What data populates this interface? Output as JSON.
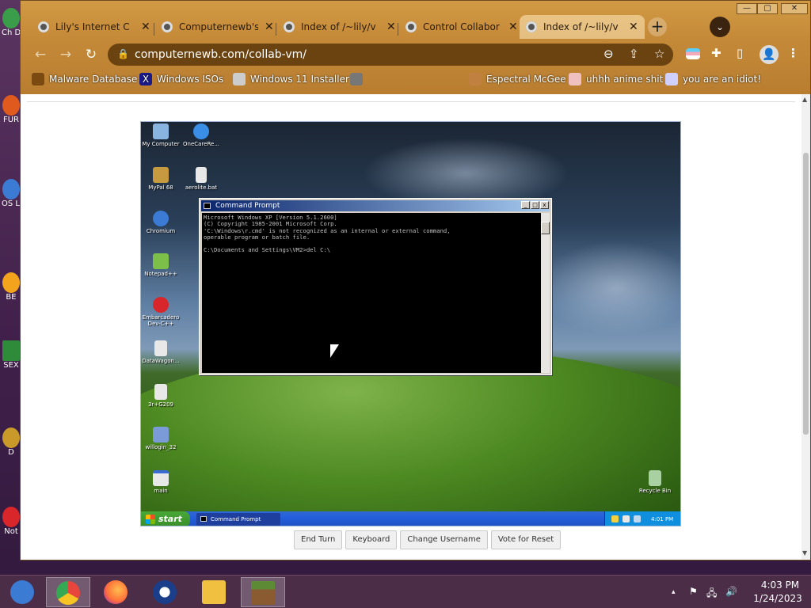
{
  "host_desktop": {
    "icons": [
      {
        "label": "Ch\nD",
        "color": "#3a9d4a"
      },
      {
        "label": "FUR",
        "color": "#e05a1e"
      },
      {
        "label": "OS\nLAU",
        "color": "#3b7bd4"
      },
      {
        "label": "BE",
        "color": "#f4a31c"
      },
      {
        "label": "SEX",
        "color": "#2e8b3a"
      },
      {
        "label": "D",
        "color": "#c99a2a"
      },
      {
        "label": "Not",
        "color": "#d8262a"
      }
    ]
  },
  "browser": {
    "tabs": [
      {
        "title": "Lily's Internet C",
        "active": false
      },
      {
        "title": "Computernewb's",
        "active": false
      },
      {
        "title": "Index of /~lily/v",
        "active": false
      },
      {
        "title": "Control Collabor",
        "active": false
      },
      {
        "title": "Index of /~lily/v",
        "active": true
      }
    ],
    "tab_close": "✕",
    "new_tab": "+",
    "tab_search": "⌄",
    "window_buttons": {
      "minimize": "—",
      "maximize": "▢",
      "close": "✕"
    },
    "nav": {
      "back": "←",
      "forward": "→",
      "reload": "↻"
    },
    "address": {
      "lock": "🔒",
      "url": "computernewb.com/collab-vm/"
    },
    "omnibox_icons": {
      "zoom": "⊖",
      "share": "⇪",
      "bookmark": "☆"
    },
    "ext_icons": {
      "extensions": "✚",
      "sidepanel": "▯",
      "profile": "👤",
      "menu": "⋮"
    },
    "bookmarks": [
      {
        "label": "Malware Database",
        "color": "#7a4a10"
      },
      {
        "label": "Windows ISOs",
        "color": "#1a1a8a"
      },
      {
        "label": "Windows 11 Installer",
        "color": "#ccc"
      },
      {
        "label": "",
        "color": "#777"
      },
      {
        "label": "Espectral McGee",
        "color": "#c08040"
      },
      {
        "label": "uhhh anime shit",
        "color": "#f0c0c0"
      },
      {
        "label": "you are an idiot!",
        "color": "#d0d0ff"
      }
    ],
    "scroll_up": "▲",
    "scroll_down": "▼"
  },
  "vm": {
    "desktop_icons": [
      {
        "label": "My Computer",
        "color": "#8ab4e0"
      },
      {
        "label": "OneCareRe...",
        "color": "#3a8ee6"
      },
      {
        "label": "MyPal 68",
        "color": "#c89a40"
      },
      {
        "label": "aerolite.bat",
        "color": "#e8e8e8"
      },
      {
        "label": "Chromium",
        "color": "#3b7bd4"
      },
      {
        "label": "Notepad++",
        "color": "#7cc04a"
      },
      {
        "label": "Embarcadero\nDev-C++",
        "color": "#d8262a"
      },
      {
        "label": "DataWagon...",
        "color": "#e8e8e8"
      },
      {
        "label": "3r+G209",
        "color": "#e8e8e8"
      },
      {
        "label": "willogin_32",
        "color": "#7a9ad8"
      },
      {
        "label": "main",
        "color": "#e8e8e8"
      },
      {
        "label": "Recycle Bin",
        "color": "#a8d0a0"
      }
    ],
    "cmd": {
      "title": "Command Prompt",
      "buttons": {
        "min": "_",
        "max": "□",
        "close": "x"
      },
      "lines": "Microsoft Windows XP [Version 5.1.2600]\n(C) Copyright 1985-2001 Microsoft Corp.\n'C:\\Windows\\r.cmd' is not recognized as an internal or external command,\noperable program or batch file.\n\nC:\\Documents and Settings\\VM2>del C:\\"
    },
    "taskbar": {
      "start": "start",
      "task_button": "Command Prompt",
      "clock": "4:01 PM"
    }
  },
  "vm_controls": [
    "End Turn",
    "Keyboard",
    "Change Username",
    "Vote for Reset"
  ],
  "taskbar": {
    "apps": [
      {
        "name": "Chromium",
        "color": "#3b7bd4"
      },
      {
        "name": "Google Chrome",
        "color": "#e8453c"
      },
      {
        "name": "Firefox",
        "color": "#ff7139"
      },
      {
        "name": "Obama",
        "color": "#1a3e8a"
      },
      {
        "name": "File Explorer",
        "color": "#f0c040"
      },
      {
        "name": "Minecraft",
        "color": "#5d8a34"
      }
    ],
    "tray": {
      "chevron": "▴",
      "flag": "⚑",
      "network": "🖧",
      "volume": "🔊"
    },
    "time": "4:03 PM",
    "date": "1/24/2023"
  }
}
